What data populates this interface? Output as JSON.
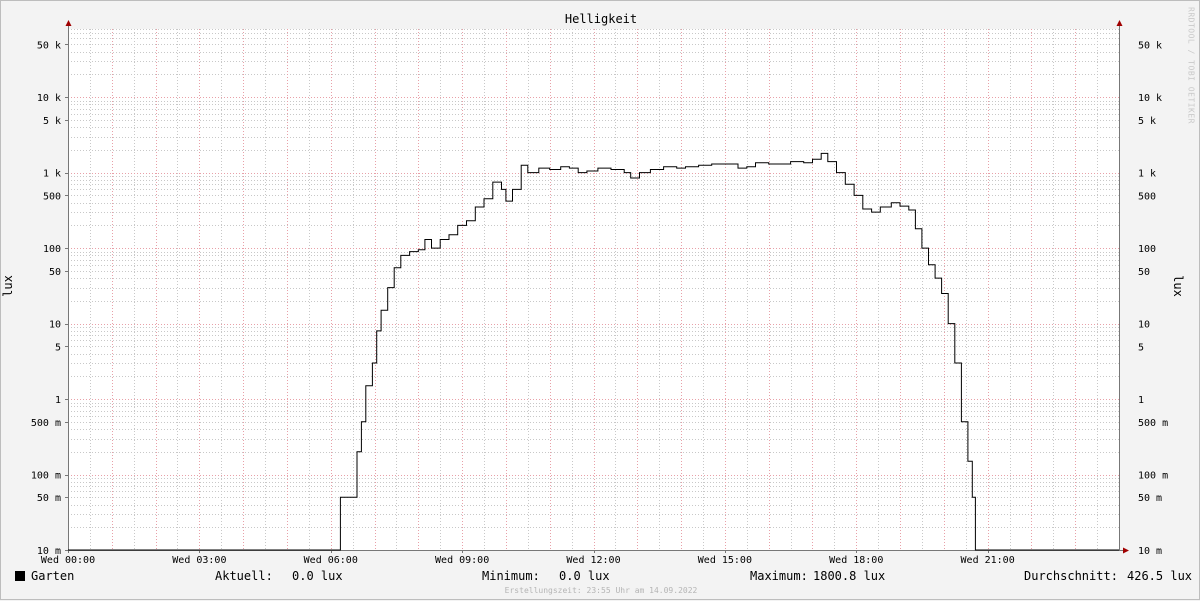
{
  "chart_data": {
    "type": "line",
    "title": "Helligkeit",
    "ylabel": "lux",
    "yscale": "log",
    "ylim": [
      0.01,
      80000
    ],
    "xlim": [
      0,
      24
    ],
    "grid": true,
    "y_ticks": [
      {
        "value": 0.01,
        "label": "10 m"
      },
      {
        "value": 0.05,
        "label": "50 m"
      },
      {
        "value": 0.1,
        "label": "100 m"
      },
      {
        "value": 0.5,
        "label": "500 m"
      },
      {
        "value": 1,
        "label": "1"
      },
      {
        "value": 5,
        "label": "5"
      },
      {
        "value": 10,
        "label": "10"
      },
      {
        "value": 50,
        "label": "50"
      },
      {
        "value": 100,
        "label": "100"
      },
      {
        "value": 500,
        "label": "500"
      },
      {
        "value": 1000,
        "label": "1 k"
      },
      {
        "value": 5000,
        "label": "5 k"
      },
      {
        "value": 10000,
        "label": "10 k"
      },
      {
        "value": 50000,
        "label": "50 k"
      }
    ],
    "x_ticks": [
      {
        "value": 0,
        "label": "Wed 00:00"
      },
      {
        "value": 3,
        "label": "Wed 03:00"
      },
      {
        "value": 6,
        "label": "Wed 06:00"
      },
      {
        "value": 9,
        "label": "Wed 09:00"
      },
      {
        "value": 12,
        "label": "Wed 12:00"
      },
      {
        "value": 15,
        "label": "Wed 15:00"
      },
      {
        "value": 18,
        "label": "Wed 18:00"
      },
      {
        "value": 21,
        "label": "Wed 21:00"
      }
    ],
    "series": [
      {
        "name": "Garten",
        "color": "#000000",
        "points": [
          [
            0,
            0.01
          ],
          [
            6.2,
            0.01
          ],
          [
            6.22,
            0.05
          ],
          [
            6.55,
            0.05
          ],
          [
            6.6,
            0.2
          ],
          [
            6.7,
            0.5
          ],
          [
            6.8,
            1.5
          ],
          [
            6.95,
            3
          ],
          [
            7.05,
            8
          ],
          [
            7.15,
            15
          ],
          [
            7.3,
            30
          ],
          [
            7.45,
            55
          ],
          [
            7.6,
            80
          ],
          [
            7.8,
            90
          ],
          [
            8.0,
            95
          ],
          [
            8.15,
            130
          ],
          [
            8.3,
            100
          ],
          [
            8.5,
            130
          ],
          [
            8.7,
            150
          ],
          [
            8.9,
            200
          ],
          [
            9.1,
            230
          ],
          [
            9.3,
            350
          ],
          [
            9.5,
            450
          ],
          [
            9.7,
            750
          ],
          [
            9.9,
            600
          ],
          [
            10.0,
            420
          ],
          [
            10.15,
            600
          ],
          [
            10.35,
            1250
          ],
          [
            10.5,
            1000
          ],
          [
            10.75,
            1150
          ],
          [
            11.0,
            1100
          ],
          [
            11.25,
            1200
          ],
          [
            11.45,
            1150
          ],
          [
            11.65,
            1000
          ],
          [
            11.85,
            1050
          ],
          [
            12.1,
            1150
          ],
          [
            12.4,
            1100
          ],
          [
            12.7,
            1000
          ],
          [
            12.85,
            850
          ],
          [
            13.05,
            1000
          ],
          [
            13.3,
            1100
          ],
          [
            13.6,
            1200
          ],
          [
            13.9,
            1150
          ],
          [
            14.1,
            1200
          ],
          [
            14.4,
            1250
          ],
          [
            14.7,
            1300
          ],
          [
            15.0,
            1300
          ],
          [
            15.3,
            1150
          ],
          [
            15.5,
            1200
          ],
          [
            15.7,
            1350
          ],
          [
            16.0,
            1300
          ],
          [
            16.2,
            1300
          ],
          [
            16.5,
            1400
          ],
          [
            16.8,
            1350
          ],
          [
            17.0,
            1500
          ],
          [
            17.2,
            1800
          ],
          [
            17.35,
            1400
          ],
          [
            17.55,
            1000
          ],
          [
            17.75,
            700
          ],
          [
            17.95,
            500
          ],
          [
            18.15,
            330
          ],
          [
            18.35,
            300
          ],
          [
            18.55,
            350
          ],
          [
            18.8,
            400
          ],
          [
            19.0,
            360
          ],
          [
            19.2,
            320
          ],
          [
            19.35,
            180
          ],
          [
            19.5,
            100
          ],
          [
            19.65,
            60
          ],
          [
            19.8,
            40
          ],
          [
            19.95,
            25
          ],
          [
            20.1,
            10
          ],
          [
            20.25,
            3
          ],
          [
            20.4,
            0.5
          ],
          [
            20.55,
            0.15
          ],
          [
            20.65,
            0.05
          ],
          [
            20.72,
            0.01
          ],
          [
            24,
            0.01
          ]
        ]
      }
    ],
    "legend": {
      "name": "Garten",
      "aktuell_label": "Aktuell:",
      "aktuell_value": "0.0 lux",
      "minimum_label": "Minimum:",
      "minimum_value": "0.0 lux",
      "maximum_label": "Maximum:",
      "maximum_value": "1800.8 lux",
      "durchschnitt_label": "Durchschnitt:",
      "durchschnitt_value": "426.5 lux"
    },
    "footer": "Erstellungszeit: 23:55 Uhr am 14.09.2022",
    "watermark": "RRDTOOL / TOBI OETIKER",
    "colors": {
      "background": "#f3f3f3",
      "plot_background": "#ffffff",
      "major_grid": "#e8a0a8",
      "minor_grid": "#c8c8c8",
      "axis": "#777777",
      "arrow": "#a00000",
      "line": "#000000"
    }
  }
}
